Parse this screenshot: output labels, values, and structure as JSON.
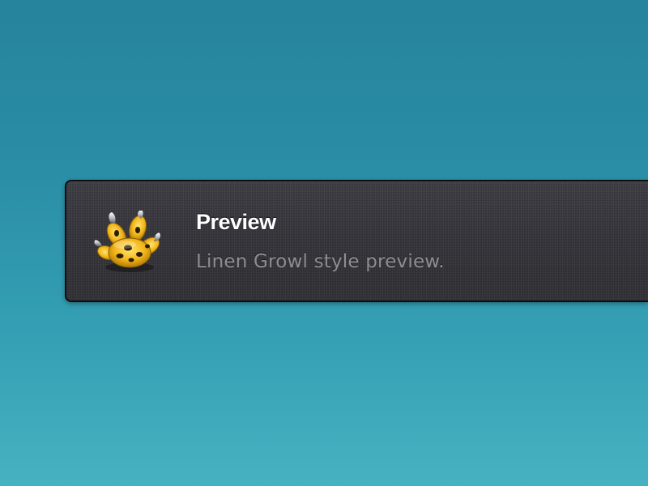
{
  "notification": {
    "title": "Preview",
    "message": "Linen Growl style preview.",
    "icon": "growl-paw-icon"
  },
  "colors": {
    "background_top": "#26849c",
    "background_bottom": "#46b2c1",
    "panel": "#35353b",
    "title": "#ffffff",
    "message": "#8e8e92",
    "icon_yellow": "#f2b51a"
  }
}
